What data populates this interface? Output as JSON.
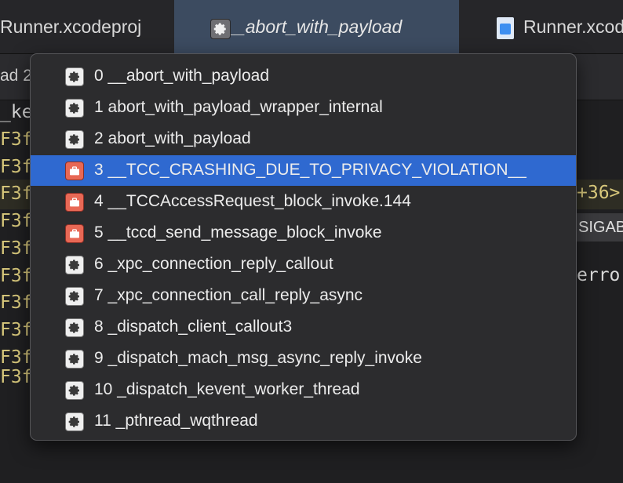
{
  "tabs": [
    {
      "label": "Runner.xcodeproj",
      "icon": "none"
    },
    {
      "label": "0 __abort_with_payload",
      "icon": "gear-icon",
      "active": true
    },
    {
      "label": "Runner.xcod",
      "icon": "xcode-document-icon"
    }
  ],
  "subbar": {
    "text": "ad 2"
  },
  "code": {
    "lines": [
      {
        "text": "_ke",
        "color": "white"
      },
      {
        "text": "F3f",
        "color": "yellow"
      },
      {
        "text": "F3f",
        "color": "yellow"
      },
      {
        "text": "F3f",
        "color": "yellow"
      },
      {
        "text": "F3f",
        "color": "yellow"
      },
      {
        "text": "F3f",
        "color": "yellow"
      },
      {
        "text": "F3f",
        "color": "yellow"
      },
      {
        "text": "F3f",
        "color": "yellow"
      },
      {
        "text": "F3f",
        "color": "yellow"
      },
      {
        "text": "F3f",
        "color": "yellow"
      },
      {
        "text": "F3f",
        "color": "yellow"
      }
    ],
    "right_fragment": "+36>",
    "signal_badge": "SIGAB",
    "error_fragment": "erro"
  },
  "menu": {
    "items": [
      {
        "label": "0 __abort_with_payload",
        "icon": "gear-icon",
        "selected": false
      },
      {
        "label": "1 abort_with_payload_wrapper_internal",
        "icon": "gear-icon",
        "selected": false
      },
      {
        "label": "2 abort_with_payload",
        "icon": "gear-icon",
        "selected": false
      },
      {
        "label": "3 __TCC_CRASHING_DUE_TO_PRIVACY_VIOLATION__",
        "icon": "briefcase-icon",
        "selected": true
      },
      {
        "label": "4 __TCCAccessRequest_block_invoke.144",
        "icon": "briefcase-icon",
        "selected": false
      },
      {
        "label": "5 __tccd_send_message_block_invoke",
        "icon": "briefcase-icon",
        "selected": false
      },
      {
        "label": "6 _xpc_connection_reply_callout",
        "icon": "gear-icon",
        "selected": false
      },
      {
        "label": "7 _xpc_connection_call_reply_async",
        "icon": "gear-icon",
        "selected": false
      },
      {
        "label": "8 _dispatch_client_callout3",
        "icon": "gear-icon",
        "selected": false
      },
      {
        "label": "9 _dispatch_mach_msg_async_reply_invoke",
        "icon": "gear-icon",
        "selected": false
      },
      {
        "label": "10 _dispatch_kevent_worker_thread",
        "icon": "gear-icon",
        "selected": false
      },
      {
        "label": "11 _pthread_wqthread",
        "icon": "gear-icon",
        "selected": false
      }
    ]
  },
  "colors": {
    "selection": "#2f69d0",
    "active_tab": "#3c4b60",
    "code_yellow": "#d9c97c",
    "briefcase_icon": "#e86855"
  }
}
